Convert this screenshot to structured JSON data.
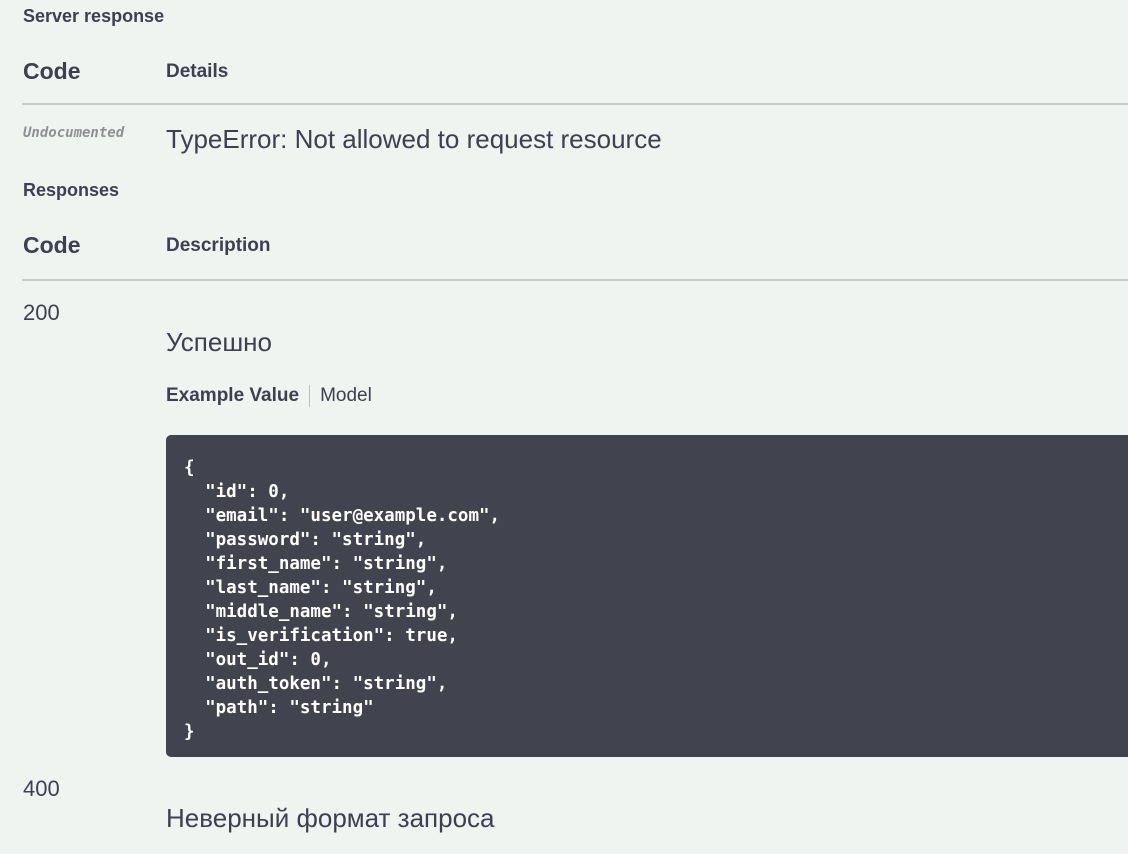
{
  "server_response": {
    "title": "Server response",
    "code_header": "Code",
    "details_header": "Details",
    "row": {
      "code": "Undocumented",
      "details": "TypeError: Not allowed to request resource"
    }
  },
  "responses": {
    "title": "Responses",
    "code_header": "Code",
    "description_header": "Description",
    "items": [
      {
        "code": "200",
        "description": "Успешно",
        "tabs": {
          "example_value": "Example Value",
          "model": "Model"
        },
        "example": "{\n  \"id\": 0,\n  \"email\": \"user@example.com\",\n  \"password\": \"string\",\n  \"first_name\": \"string\",\n  \"last_name\": \"string\",\n  \"middle_name\": \"string\",\n  \"is_verification\": true,\n  \"out_id\": 0,\n  \"auth_token\": \"string\",\n  \"path\": \"string\"\n}"
      },
      {
        "code": "400",
        "description": "Неверный формат запроса"
      }
    ]
  },
  "colors": {
    "background": "#eef4ef",
    "text": "#3b4151",
    "code_background": "#41444e",
    "rule": "#c6ccc9"
  }
}
